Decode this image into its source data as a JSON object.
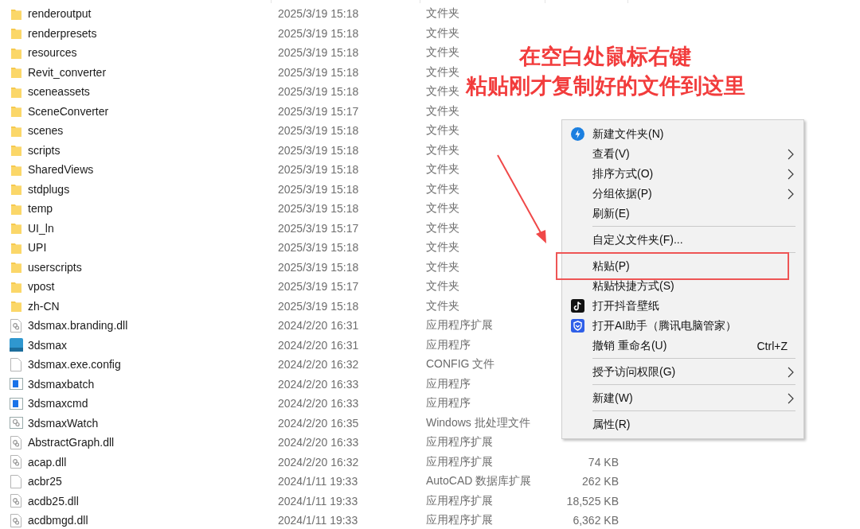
{
  "files": [
    {
      "name": "renderoutput",
      "modified": "2025/3/19 15:18",
      "type": "文件夹",
      "kind": "folder"
    },
    {
      "name": "renderpresets",
      "modified": "2025/3/19 15:18",
      "type": "文件夹",
      "kind": "folder"
    },
    {
      "name": "resources",
      "modified": "2025/3/19 15:18",
      "type": "文件夹",
      "kind": "folder"
    },
    {
      "name": "Revit_converter",
      "modified": "2025/3/19 15:18",
      "type": "文件夹",
      "kind": "folder"
    },
    {
      "name": "sceneassets",
      "modified": "2025/3/19 15:18",
      "type": "文件夹",
      "kind": "folder"
    },
    {
      "name": "SceneConverter",
      "modified": "2025/3/19 15:17",
      "type": "文件夹",
      "kind": "folder"
    },
    {
      "name": "scenes",
      "modified": "2025/3/19 15:18",
      "type": "文件夹",
      "kind": "folder"
    },
    {
      "name": "scripts",
      "modified": "2025/3/19 15:18",
      "type": "文件夹",
      "kind": "folder"
    },
    {
      "name": "SharedViews",
      "modified": "2025/3/19 15:18",
      "type": "文件夹",
      "kind": "folder"
    },
    {
      "name": "stdplugs",
      "modified": "2025/3/19 15:18",
      "type": "文件夹",
      "kind": "folder"
    },
    {
      "name": "temp",
      "modified": "2025/3/19 15:18",
      "type": "文件夹",
      "kind": "folder"
    },
    {
      "name": "UI_ln",
      "modified": "2025/3/19 15:17",
      "type": "文件夹",
      "kind": "folder"
    },
    {
      "name": "UPI",
      "modified": "2025/3/19 15:18",
      "type": "文件夹",
      "kind": "folder"
    },
    {
      "name": "userscripts",
      "modified": "2025/3/19 15:18",
      "type": "文件夹",
      "kind": "folder"
    },
    {
      "name": "vpost",
      "modified": "2025/3/19 15:17",
      "type": "文件夹",
      "kind": "folder"
    },
    {
      "name": "zh-CN",
      "modified": "2025/3/19 15:18",
      "type": "文件夹",
      "kind": "folder"
    },
    {
      "name": "3dsmax.branding.dll",
      "modified": "2024/2/20 16:31",
      "type": "应用程序扩展",
      "kind": "dll"
    },
    {
      "name": "3dsmax",
      "modified": "2024/2/20 16:31",
      "type": "应用程序",
      "kind": "max"
    },
    {
      "name": "3dsmax.exe.config",
      "modified": "2024/2/20 16:32",
      "type": "CONFIG 文件",
      "kind": "file"
    },
    {
      "name": "3dsmaxbatch",
      "modified": "2024/2/20 16:33",
      "type": "应用程序",
      "kind": "exe"
    },
    {
      "name": "3dsmaxcmd",
      "modified": "2024/2/20 16:33",
      "type": "应用程序",
      "kind": "exe"
    },
    {
      "name": "3dsmaxWatch",
      "modified": "2024/2/20 16:35",
      "type": "Windows 批处理文件",
      "kind": "bat"
    },
    {
      "name": "AbstractGraph.dll",
      "modified": "2024/2/20 16:33",
      "type": "应用程序扩展",
      "kind": "dll"
    },
    {
      "name": "acap.dll",
      "modified": "2024/2/20 16:32",
      "type": "应用程序扩展",
      "kind": "dll",
      "size": "74 KB"
    },
    {
      "name": "acbr25",
      "modified": "2024/1/11 19:33",
      "type": "AutoCAD 数据库扩展",
      "kind": "file",
      "size": "262 KB"
    },
    {
      "name": "acdb25.dll",
      "modified": "2024/1/11 19:33",
      "type": "应用程序扩展",
      "kind": "dll",
      "size": "18,525 KB"
    },
    {
      "name": "acdbmgd.dll",
      "modified": "2024/1/11 19:33",
      "type": "应用程序扩展",
      "kind": "dll",
      "size": "6,362 KB"
    }
  ],
  "context_menu": [
    {
      "kind": "bolt",
      "label": "新建文件夹(N)",
      "submenu": false,
      "highlighted": false
    },
    {
      "kind": "item",
      "label": "查看(V)",
      "submenu": true,
      "highlighted": false
    },
    {
      "kind": "item",
      "label": "排序方式(O)",
      "submenu": true,
      "highlighted": false
    },
    {
      "kind": "item",
      "label": "分组依据(P)",
      "submenu": true,
      "highlighted": false
    },
    {
      "kind": "item",
      "label": "刷新(E)",
      "submenu": false,
      "highlighted": false
    },
    {
      "kind": "separator"
    },
    {
      "kind": "item",
      "label": "自定义文件夹(F)...",
      "submenu": false,
      "highlighted": false
    },
    {
      "kind": "separator"
    },
    {
      "kind": "item",
      "label": "粘贴(P)",
      "submenu": false,
      "highlighted": true
    },
    {
      "kind": "item",
      "label": "粘贴快捷方式(S)",
      "submenu": false,
      "highlighted": false
    },
    {
      "kind": "note",
      "label": "打开抖音壁纸",
      "submenu": false,
      "highlighted": false
    },
    {
      "kind": "shield",
      "label": "打开AI助手（腾讯电脑管家）",
      "submenu": false,
      "highlighted": false
    },
    {
      "kind": "item",
      "label": "撤销 重命名(U)",
      "shortcut": "Ctrl+Z",
      "submenu": false,
      "highlighted": false
    },
    {
      "kind": "separator"
    },
    {
      "kind": "item",
      "label": "授予访问权限(G)",
      "submenu": true,
      "highlighted": false
    },
    {
      "kind": "separator"
    },
    {
      "kind": "item",
      "label": "新建(W)",
      "submenu": true,
      "highlighted": false
    },
    {
      "kind": "separator"
    },
    {
      "kind": "item",
      "label": "属性(R)",
      "submenu": false,
      "highlighted": false
    }
  ],
  "annotation": {
    "lines": [
      "在空白处鼠标右键",
      "粘贴刚才复制好的文件到这里"
    ]
  }
}
